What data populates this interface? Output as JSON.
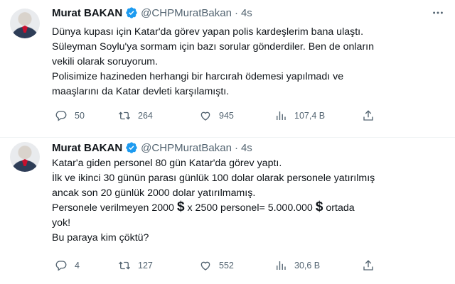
{
  "tweets": [
    {
      "author": "Murat BAKAN",
      "handle": "@CHPMuratBakan",
      "separator": "·",
      "time": "4s",
      "lines": [
        "Dünya kupası için Katar'da görev yapan polis kardeşlerim bana ulaştı.",
        "Süleyman Soylu'ya sormam için bazı sorular gönderdiler. Ben de onların",
        "vekili olarak soruyorum.",
        "Polisimize hazineden herhangi bir harcırah ödemesi yapılmadı ve",
        "maaşlarını da Katar devleti karşılamıştı."
      ],
      "replies": "50",
      "retweets": "264",
      "likes": "945",
      "views": "107,4 B"
    },
    {
      "author": "Murat BAKAN",
      "handle": "@CHPMuratBakan",
      "separator": "·",
      "time": "4s",
      "lines": [
        "Katar'a giden personel 80 gün Katar'da görev yaptı.",
        "İlk ve ikinci 30 günün parası günlük 100 dolar olarak personele yatırılmış",
        "ancak son 20 günlük 2000 dolar yatırılmamış."
      ],
      "line4_a": "Personele verilmeyen 2000",
      "line4_b": "x 2500 personel= 5.000.000",
      "line4_c": "ortada",
      "line5": "yok!",
      "line6": "Bu paraya kim çöktü?",
      "dollar": "$",
      "replies": "4",
      "retweets": "127",
      "likes": "552",
      "views": "30,6 B"
    }
  ],
  "colors": {
    "accent": "#1d9bf0",
    "muted": "#536471",
    "text": "#0f1419",
    "divider": "#eff3f4"
  },
  "icons": [
    "verified-badge-icon",
    "more-icon",
    "reply-icon",
    "retweet-icon",
    "like-icon",
    "views-icon",
    "share-icon"
  ]
}
